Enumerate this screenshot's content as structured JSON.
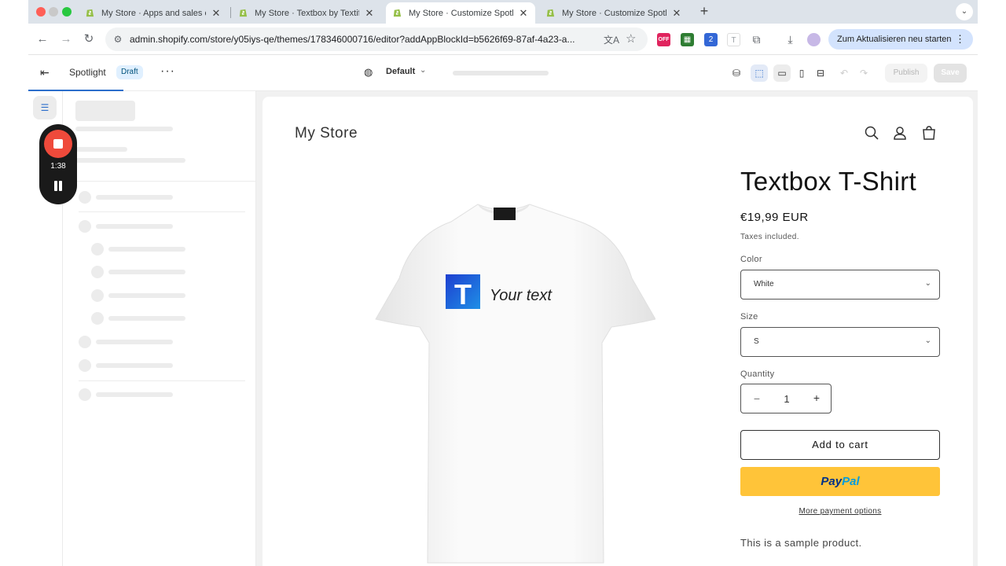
{
  "browser": {
    "tabs": [
      {
        "title": "My Store · Apps and sales ch",
        "active": false
      },
      {
        "title": "My Store · Textbox by Textify",
        "active": false
      },
      {
        "title": "My Store · Customize Spotlig",
        "active": true
      },
      {
        "title": "My Store · Customize Spotlig",
        "active": false
      }
    ],
    "url": "admin.shopify.com/store/y05iys-qe/themes/178346000716/editor?addAppBlockId=b5626f69-87af-4a23-a...",
    "update_button": "Zum Aktualisieren neu starten",
    "extension_badge": "2",
    "extension_off_label": "OFF"
  },
  "editor": {
    "theme_name": "Spotlight",
    "status_badge": "Draft",
    "template": "Default",
    "publish_label": "Publish",
    "save_label": "Save"
  },
  "recorder": {
    "time": "1:38"
  },
  "store": {
    "name": "My Store"
  },
  "product": {
    "title": "Textbox T-Shirt",
    "price": "€19,99 EUR",
    "taxes_note": "Taxes included.",
    "color_label": "Color",
    "color_value": "White",
    "size_label": "Size",
    "size_value": "S",
    "quantity_label": "Quantity",
    "quantity": "1",
    "add_to_cart": "Add to cart",
    "paypal_p1": "Pay",
    "paypal_p2": "Pal",
    "more_payment": "More payment options",
    "description": "This is a sample product.",
    "shirt_print_text": "Your text",
    "shirt_logo_letter": "T"
  },
  "icons": {
    "store_header": [
      "search-icon",
      "account-icon",
      "cart-icon"
    ],
    "editor_header": [
      "exit-icon",
      "more-icon",
      "globe-icon",
      "chevron-down-icon",
      "app-embeds-icon",
      "inspector-icon",
      "desktop-icon",
      "mobile-icon",
      "fullwidth-icon",
      "undo-icon",
      "redo-icon"
    ]
  },
  "colors": {
    "paypal": "#ffc439",
    "draft_badge_bg": "#e0f0ff",
    "recorder_stop": "#ef4a3b",
    "editor_accent": "#2c6ecb"
  }
}
